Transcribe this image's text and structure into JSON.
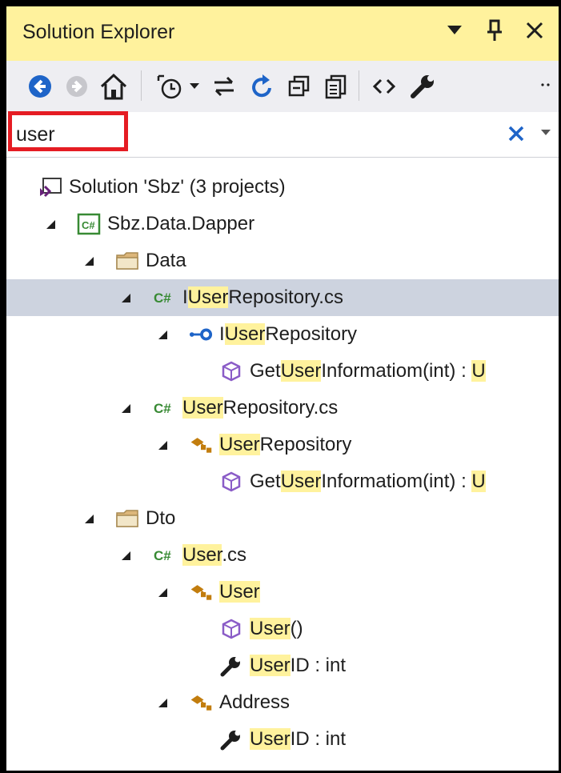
{
  "panel": {
    "title": "Solution Explorer",
    "title_buttons": [
      "dropdown-icon",
      "pin-icon",
      "close-icon"
    ]
  },
  "toolbar": {
    "icons": [
      "back-icon",
      "forward-icon",
      "home-icon",
      "pending-changes-icon",
      "pending-dropdown-icon",
      "sync-icon",
      "refresh-icon",
      "collapse-all-icon",
      "show-all-files-icon",
      "view-code-icon",
      "properties-icon",
      "overflow-icon"
    ]
  },
  "search": {
    "value": "user",
    "clear_icon": "clear-icon",
    "dropdown_icon": "search-options-icon"
  },
  "colors": {
    "title_bg": "#fff29d",
    "highlight": "#fff29d",
    "selection": "#cdd3df",
    "annotation_box": "#e51c23",
    "toolbar_blue": "#1e64c8",
    "csharp_green": "#388a34",
    "method_purple": "#8a5cc7",
    "class_orange": "#c27d0e"
  },
  "tree": {
    "rows": [
      {
        "icon": "solution-icon",
        "parts": [
          {
            "t": "Solution 'Sbz' (3 projects)",
            "h": false
          }
        ]
      },
      {
        "icon": "csharp-project-icon",
        "parts": [
          {
            "t": "Sbz.Data.Dapper",
            "h": false
          }
        ]
      },
      {
        "icon": "folder-icon",
        "parts": [
          {
            "t": "Data",
            "h": false
          }
        ]
      },
      {
        "icon": "csharp-file-icon",
        "parts": [
          {
            "t": "I",
            "h": false
          },
          {
            "t": "User",
            "h": true
          },
          {
            "t": "Repository.cs",
            "h": false
          }
        ]
      },
      {
        "icon": "interface-icon",
        "parts": [
          {
            "t": "I",
            "h": false
          },
          {
            "t": "User",
            "h": true
          },
          {
            "t": "Repository",
            "h": false
          }
        ]
      },
      {
        "icon": "method-icon",
        "parts": [
          {
            "t": "Get",
            "h": false
          },
          {
            "t": "User",
            "h": true
          },
          {
            "t": "Informatiom(int) : ",
            "h": false
          },
          {
            "t": "U",
            "h": true
          }
        ]
      },
      {
        "icon": "csharp-file-icon",
        "parts": [
          {
            "t": "User",
            "h": true
          },
          {
            "t": "Repository.cs",
            "h": false
          }
        ]
      },
      {
        "icon": "class-icon",
        "parts": [
          {
            "t": "User",
            "h": true
          },
          {
            "t": "Repository",
            "h": false
          }
        ]
      },
      {
        "icon": "method-icon",
        "parts": [
          {
            "t": "Get",
            "h": false
          },
          {
            "t": "User",
            "h": true
          },
          {
            "t": "Informatiom(int) : ",
            "h": false
          },
          {
            "t": "U",
            "h": true
          }
        ]
      },
      {
        "icon": "folder-icon",
        "parts": [
          {
            "t": "Dto",
            "h": false
          }
        ]
      },
      {
        "icon": "csharp-file-icon",
        "parts": [
          {
            "t": "User",
            "h": true
          },
          {
            "t": ".cs",
            "h": false
          }
        ]
      },
      {
        "icon": "class-icon",
        "parts": [
          {
            "t": "User",
            "h": true
          }
        ]
      },
      {
        "icon": "method-icon",
        "parts": [
          {
            "t": "User",
            "h": true
          },
          {
            "t": "()",
            "h": false
          }
        ]
      },
      {
        "icon": "property-icon",
        "parts": [
          {
            "t": "User",
            "h": true
          },
          {
            "t": "ID : int",
            "h": false
          }
        ]
      },
      {
        "icon": "class-icon",
        "parts": [
          {
            "t": "Address",
            "h": false
          }
        ]
      },
      {
        "icon": "property-icon",
        "parts": [
          {
            "t": "User",
            "h": true
          },
          {
            "t": "ID : int",
            "h": false
          }
        ]
      }
    ]
  }
}
